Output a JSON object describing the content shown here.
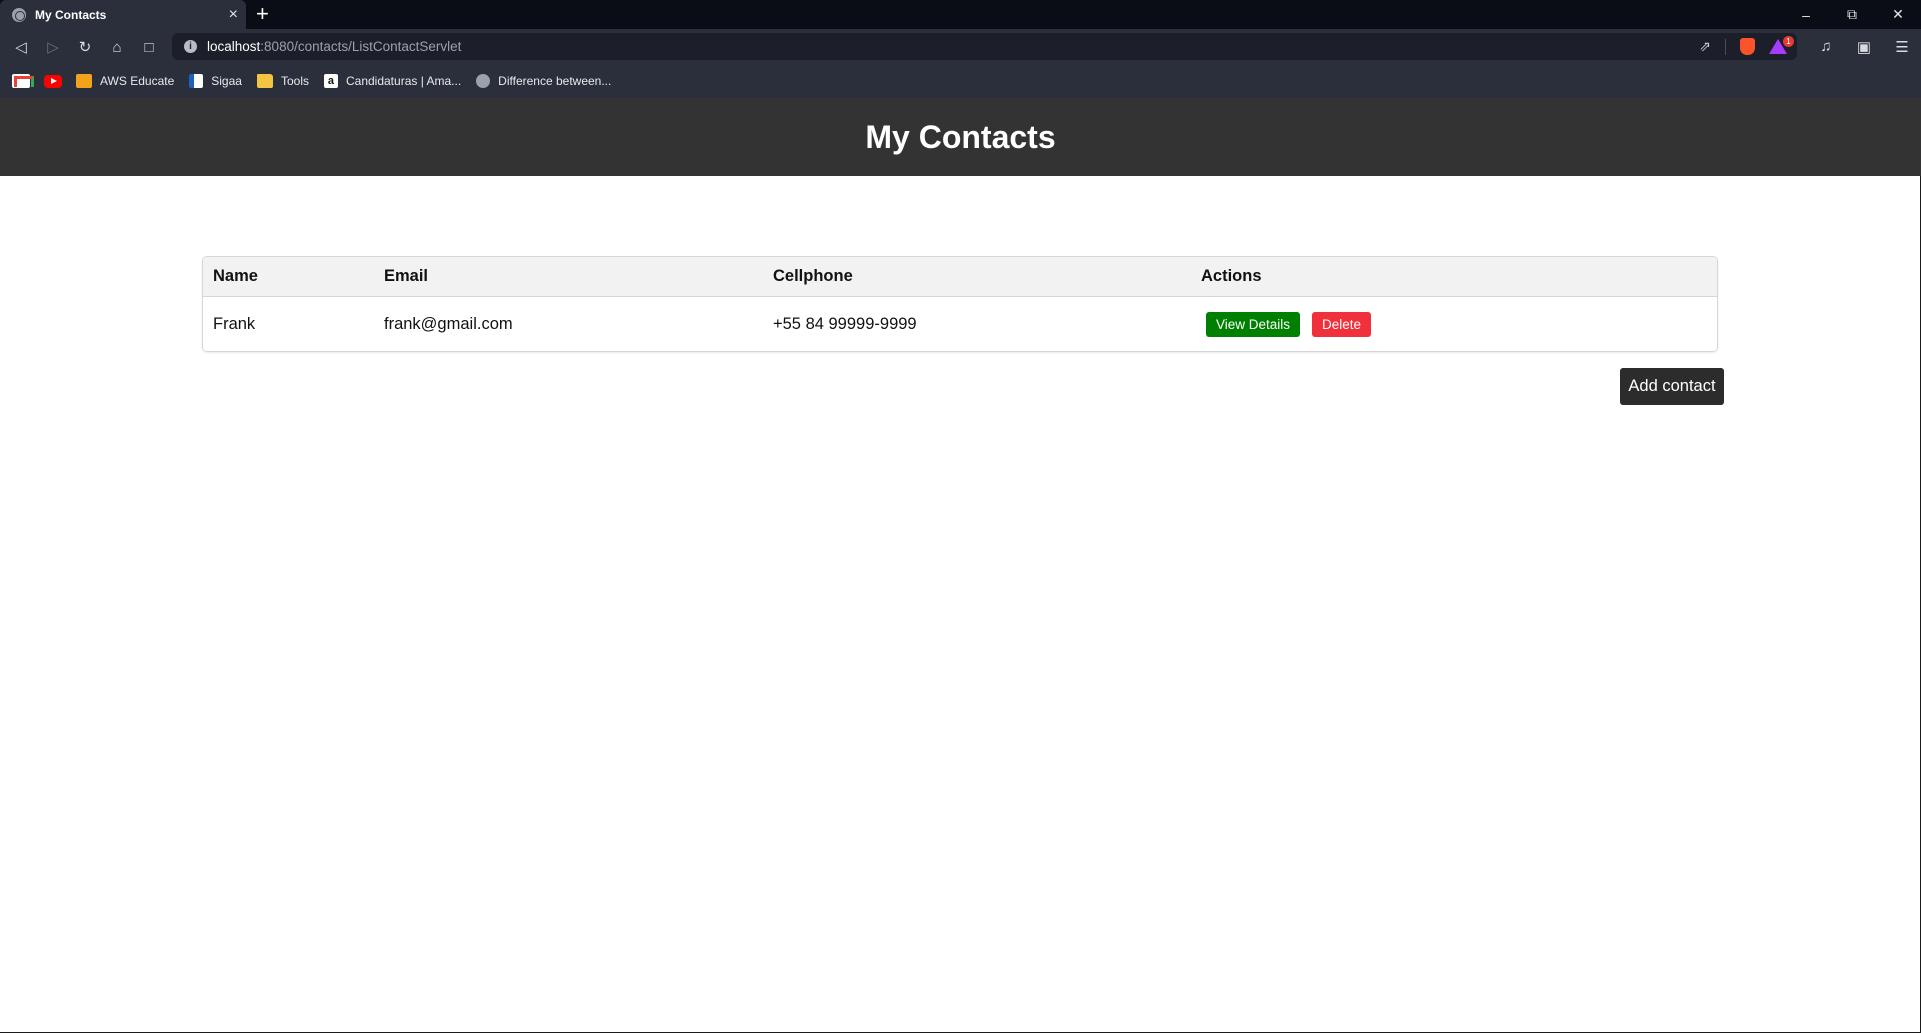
{
  "browser": {
    "tab_title": "My Contacts",
    "tab_close": "×",
    "new_tab": "+",
    "url_host": "localhost",
    "url_rest": ":8080/contacts/ListContactServlet",
    "rewards_count": "1",
    "bookmarks": [
      {
        "label": "AWS Educate"
      },
      {
        "label": "Sigaa"
      },
      {
        "label": "Tools"
      },
      {
        "label": "Candidaturas | Ama..."
      },
      {
        "label": "Difference between..."
      }
    ],
    "icons": {
      "back": "back-arrow-icon",
      "forward": "forward-arrow-icon",
      "reload": "reload-icon",
      "home": "home-icon",
      "bookmark": "bookmark-icon",
      "share": "share-icon",
      "brave_shields": "brave-shields-icon",
      "rewards": "brave-rewards-icon",
      "music": "music-icon",
      "wallet": "wallet-icon",
      "menu": "hamburger-menu-icon"
    }
  },
  "page": {
    "title": "My Contacts",
    "table": {
      "headers": [
        "Name",
        "Email",
        "Cellphone",
        "Actions"
      ],
      "rows": [
        {
          "name": "Frank",
          "email": "frank@gmail.com",
          "cellphone": "+55 84 99999-9999",
          "view_label": "View Details",
          "delete_label": "Delete"
        }
      ]
    },
    "add_contact_label": "Add contact"
  },
  "colors": {
    "header_bg": "#333333",
    "view_button": "#008000",
    "delete_button": "#f0303a",
    "add_button": "#2c2c2c"
  }
}
